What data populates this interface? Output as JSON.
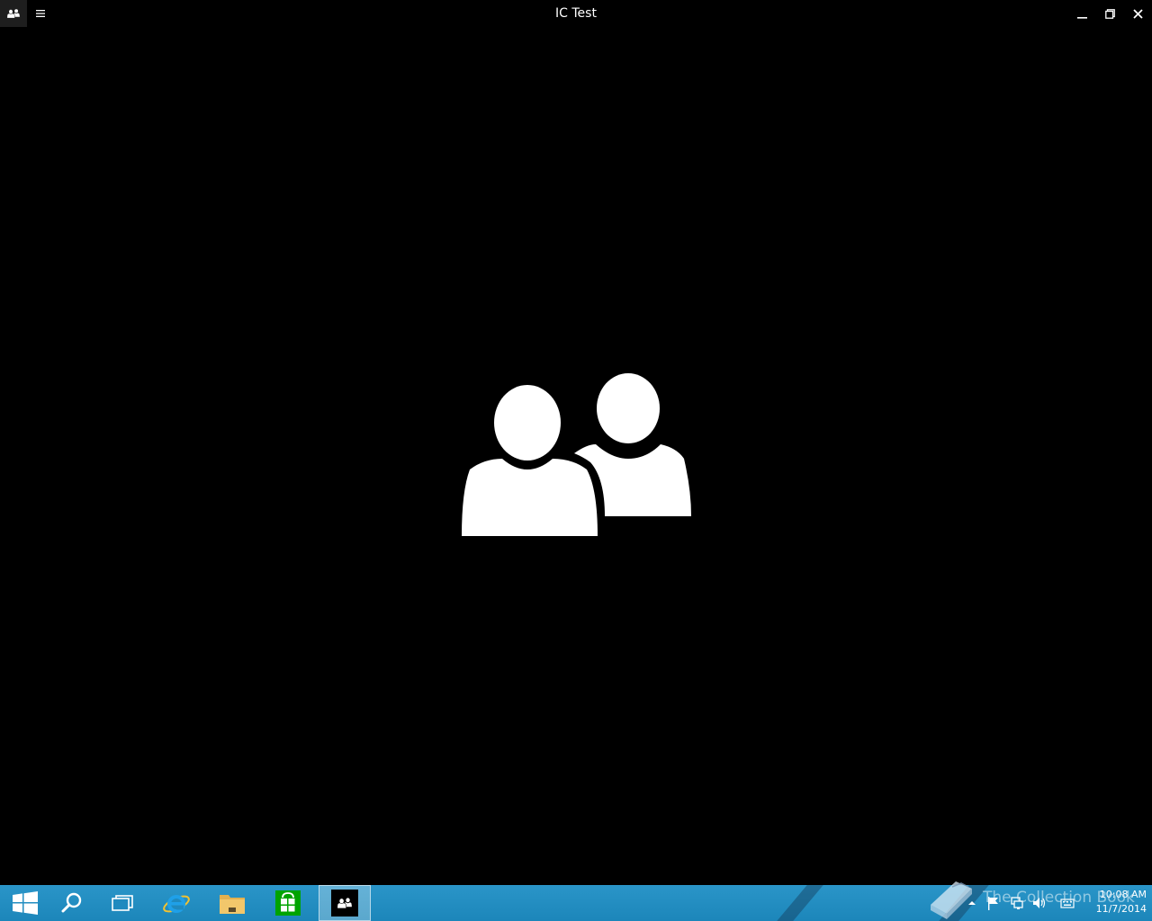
{
  "window": {
    "title": "IC Test",
    "buttons": {
      "app_icon": "people-icon",
      "menu": "hamburger-menu-icon",
      "minimize": "minimize-icon",
      "maximize": "restore-icon",
      "close": "close-icon"
    }
  },
  "splash": {
    "icon": "people-icon"
  },
  "taskbar": {
    "items": [
      {
        "name": "start",
        "icon": "windows-logo-icon"
      },
      {
        "name": "search",
        "icon": "search-icon"
      },
      {
        "name": "task-view",
        "icon": "task-view-icon"
      },
      {
        "name": "internet-explorer",
        "icon": "internet-explorer-icon"
      },
      {
        "name": "file-explorer",
        "icon": "folder-icon"
      },
      {
        "name": "store",
        "icon": "store-icon"
      },
      {
        "name": "ic-test",
        "icon": "people-icon",
        "active": true
      }
    ],
    "tray": {
      "icons": [
        "show-hidden-icons-chevron",
        "action-center-flag-icon",
        "network-icon",
        "volume-icon",
        "keyboard-icon"
      ]
    },
    "clock": {
      "time": "10:08 AM",
      "date": "11/7/2014"
    }
  },
  "watermark": {
    "text": "The Collection Book"
  },
  "colors": {
    "background": "#000000",
    "taskbar": "#2390c4",
    "store_green": "#00a300",
    "folder_yellow": "#f2c76b"
  }
}
